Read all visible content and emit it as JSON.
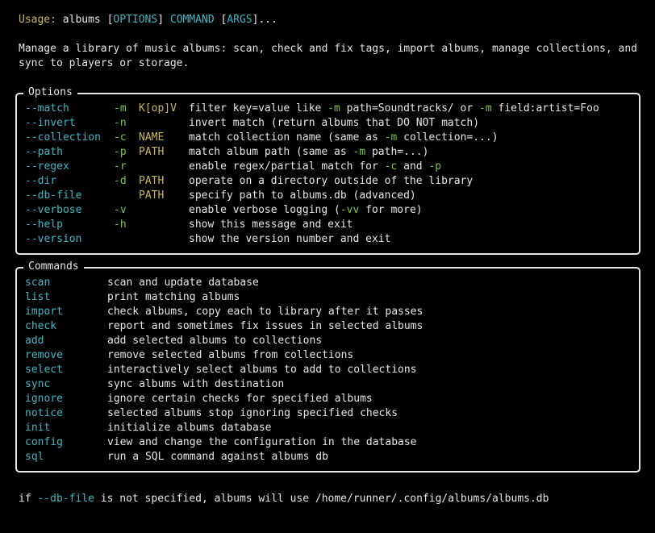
{
  "usage": {
    "label": "Usage:",
    "prog": "albums",
    "b1": "[",
    "options": "OPTIONS",
    "b2": "]",
    "command": "COMMAND",
    "b3": "[",
    "args": "ARGS",
    "tail": "]..."
  },
  "description": {
    "line1": "Manage a library of music albums: scan, check and fix tags, import albums, manage collections, and",
    "line2": "sync to players or storage."
  },
  "options_panel": {
    "title": "Options",
    "rows": [
      {
        "long": "--match",
        "short": "-m",
        "arg": "K[op]V",
        "desc": [
          {
            "t": "filter key=value like ",
            "c": "white"
          },
          {
            "t": "-m",
            "c": "green"
          },
          {
            "t": " path=Soundtracks/ or ",
            "c": "white"
          },
          {
            "t": "-m",
            "c": "green"
          },
          {
            "t": " field:artist=Foo",
            "c": "white"
          }
        ]
      },
      {
        "long": "--invert",
        "short": "-n",
        "arg": "",
        "desc": [
          {
            "t": "invert match (return albums that DO NOT match)",
            "c": "white"
          }
        ]
      },
      {
        "long": "--collection",
        "short": "-c",
        "arg": "NAME",
        "desc": [
          {
            "t": "match collection name (same as ",
            "c": "white"
          },
          {
            "t": "-m",
            "c": "green"
          },
          {
            "t": " collection=...)",
            "c": "white"
          }
        ]
      },
      {
        "long": "--path",
        "short": "-p",
        "arg": "PATH",
        "desc": [
          {
            "t": "match album path (same as ",
            "c": "white"
          },
          {
            "t": "-m",
            "c": "green"
          },
          {
            "t": " path=...)",
            "c": "white"
          }
        ]
      },
      {
        "long": "--regex",
        "short": "-r",
        "arg": "",
        "desc": [
          {
            "t": "enable regex/partial match for ",
            "c": "white"
          },
          {
            "t": "-c",
            "c": "green"
          },
          {
            "t": " and ",
            "c": "white"
          },
          {
            "t": "-p",
            "c": "green"
          }
        ]
      },
      {
        "long": "--dir",
        "short": "-d",
        "arg": "PATH",
        "desc": [
          {
            "t": "operate on a directory outside of the library",
            "c": "white"
          }
        ]
      },
      {
        "long": "--db-file",
        "short": "",
        "arg": "PATH",
        "desc": [
          {
            "t": "specify path to albums.db (advanced)",
            "c": "white"
          }
        ]
      },
      {
        "long": "--verbose",
        "short": "-v",
        "arg": "",
        "desc": [
          {
            "t": "enable verbose logging (",
            "c": "white"
          },
          {
            "t": "-vv",
            "c": "green"
          },
          {
            "t": " for more)",
            "c": "white"
          }
        ]
      },
      {
        "long": "--help",
        "short": "-h",
        "arg": "",
        "desc": [
          {
            "t": "show this message and exit",
            "c": "white"
          }
        ]
      },
      {
        "long": "--version",
        "short": "",
        "arg": "",
        "desc": [
          {
            "t": "show the version number and exit",
            "c": "white"
          }
        ]
      }
    ]
  },
  "commands_panel": {
    "title": "Commands",
    "rows": [
      {
        "name": "scan",
        "desc": "scan and update database"
      },
      {
        "name": "list",
        "desc": "print matching albums"
      },
      {
        "name": "import",
        "desc": "check albums, copy each to library after it passes"
      },
      {
        "name": "check",
        "desc": "report and sometimes fix issues in selected albums"
      },
      {
        "name": "add",
        "desc": "add selected albums to collections"
      },
      {
        "name": "remove",
        "desc": "remove selected albums from collections"
      },
      {
        "name": "select",
        "desc": "interactively select albums to add to collections"
      },
      {
        "name": "sync",
        "desc": "sync albums with destination"
      },
      {
        "name": "ignore",
        "desc": "ignore certain checks for specified albums"
      },
      {
        "name": "notice",
        "desc": "selected albums stop ignoring specified checks"
      },
      {
        "name": "init",
        "desc": "initialize albums database"
      },
      {
        "name": "config",
        "desc": "view and change the configuration in the database"
      },
      {
        "name": "sql",
        "desc": "run a SQL command against albums db"
      }
    ]
  },
  "footer": {
    "pre": "if ",
    "flag": "--db-file",
    "post": " is not specified, albums will use /home/runner/.config/albums/albums.db"
  },
  "colors": {
    "background": "#000000",
    "foreground": "#e6e6e6",
    "yellow": "#c7b85a",
    "cyan": "#3fb7c5",
    "green": "#79c34a"
  }
}
